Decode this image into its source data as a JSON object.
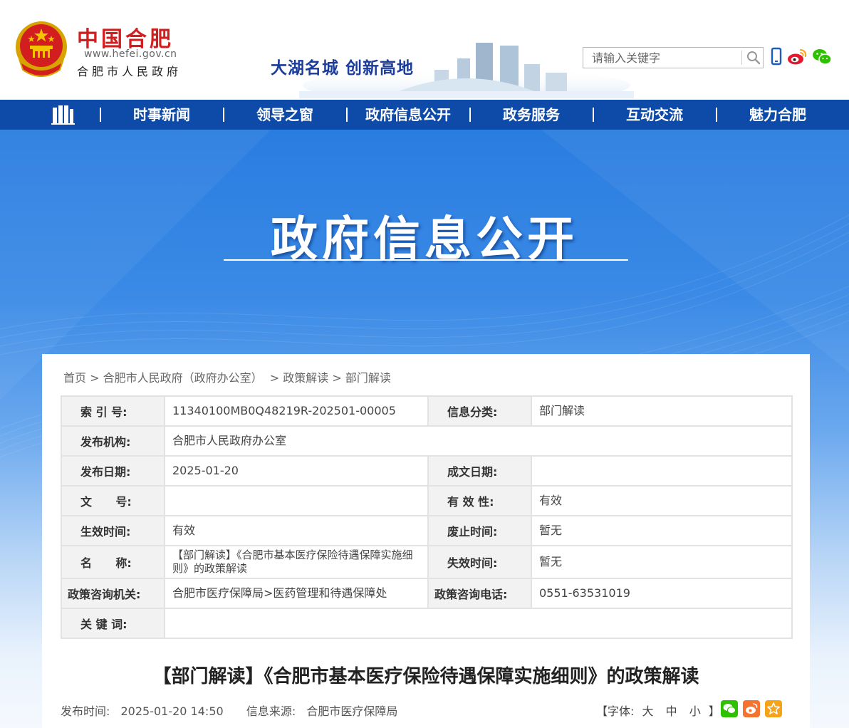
{
  "header": {
    "site_name": "中国合肥",
    "site_url": "www.hefei.gov.cn",
    "site_org": "合肥市人民政府",
    "slogan": "大湖名城   创新高地",
    "search_placeholder": "请输入关键字",
    "icons": [
      "mobile-icon",
      "weibo-icon",
      "wechat-icon",
      "search-icon"
    ]
  },
  "nav": {
    "items": [
      "时事新闻",
      "领导之窗",
      "政府信息公开",
      "政务服务",
      "互动交流",
      "魅力合肥"
    ]
  },
  "banner": {
    "title": "政府信息公开"
  },
  "breadcrumb": [
    "首页",
    "合肥市人民政府（政府办公室）",
    "政策解读",
    "部门解读"
  ],
  "meta": {
    "index_label": "索 引 号:",
    "index_value": "11340100MB0Q48219R-202501-00005",
    "category_label": "信息分类:",
    "category_value": "部门解读",
    "publisher_label": "发布机构:",
    "publisher_value": "合肥市人民政府办公室",
    "pub_date_label": "发布日期:",
    "pub_date_value": "2025-01-20",
    "write_date_label": "成文日期:",
    "write_date_value": "",
    "doc_no_label": "文      号:",
    "doc_no_value": "",
    "validity_label": "有 效 性:",
    "validity_value": "有效",
    "effective_label": "生效时间:",
    "effective_value": "有效",
    "repeal_label": "废止时间:",
    "repeal_value": "暂无",
    "name_label": "名      称:",
    "name_value": "【部门解读】《合肥市基本医疗保险待遇保障实施细则》的政策解读",
    "expire_label": "失效时间:",
    "expire_value": "暂无",
    "consult_org_label": "政策咨询机关:",
    "consult_org_value": "合肥市医疗保障局>医药管理和待遇保障处",
    "consult_tel_label": "政策咨询电话:",
    "consult_tel_value": "0551-63531019",
    "keywords_label": "关 键 词:",
    "keywords_value": ""
  },
  "article": {
    "title": "【部门解读】《合肥市基本医疗保险待遇保障实施细则》的政策解读",
    "pub_time_label": "发布时间:",
    "pub_time_value": "2025-01-20 14:50",
    "source_label": "信息来源:",
    "source_value": "合肥市医疗保障局",
    "font_label_open": "【字体:",
    "font_large": "大",
    "font_medium": "中",
    "font_small": "小",
    "font_label_close": "】"
  },
  "colors": {
    "brand_red": "#d21e1e",
    "nav_blue": "#0e4ba8",
    "wechat_green": "#2dc100",
    "weibo_orange": "#f5732e",
    "favorite_orange": "#f7a21b"
  }
}
